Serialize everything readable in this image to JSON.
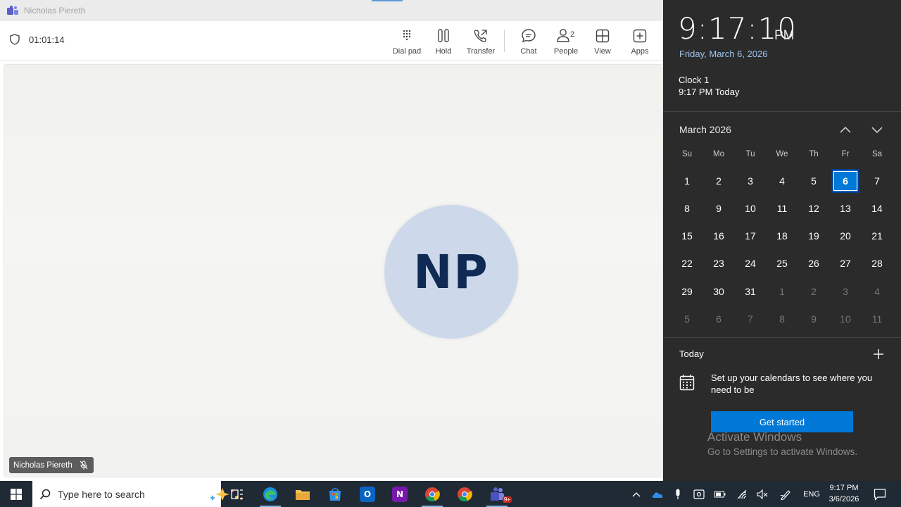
{
  "window": {
    "title": "Nicholas Piereth",
    "call_timer": "01:01:14",
    "controls": [
      {
        "label": "Dial pad",
        "icon": "dialpad-icon"
      },
      {
        "label": "Hold",
        "icon": "hold-icon"
      },
      {
        "label": "Transfer",
        "icon": "transfer-icon"
      },
      {
        "label": "Chat",
        "icon": "chat-icon"
      },
      {
        "label": "People",
        "icon": "people-icon",
        "count": "2"
      },
      {
        "label": "View",
        "icon": "view-icon"
      },
      {
        "label": "Apps",
        "icon": "apps-icon"
      }
    ],
    "avatar_initials": "NP",
    "participant_name": "Nicholas Piereth",
    "avatar_color": "#cdd9ea"
  },
  "flyout": {
    "time": "9:17:10",
    "ampm": "PM",
    "date": "Friday, March 6, 2026",
    "clock_name": "Clock 1",
    "clock_time": "9:17 PM Today",
    "month": "March 2026",
    "weekdays": [
      "Su",
      "Mo",
      "Tu",
      "We",
      "Th",
      "Fr",
      "Sa"
    ],
    "weeks": [
      [
        "1",
        "2",
        "3",
        "4",
        "5",
        "6",
        "7"
      ],
      [
        "8",
        "9",
        "10",
        "11",
        "12",
        "13",
        "14"
      ],
      [
        "15",
        "16",
        "17",
        "18",
        "19",
        "20",
        "21"
      ],
      [
        "22",
        "23",
        "24",
        "25",
        "26",
        "27",
        "28"
      ],
      [
        "29",
        "30",
        "31",
        "1",
        "2",
        "3",
        "4"
      ],
      [
        "5",
        "6",
        "7",
        "8",
        "9",
        "10",
        "11"
      ]
    ],
    "today_label": "Today",
    "setup_text": "Set up your calendars to see where you need to be",
    "get_started": "Get started",
    "watermark_title": "Activate Windows",
    "watermark_sub": "Go to Settings to activate Windows.",
    "accent": "#0078d7"
  },
  "taskbar": {
    "search_placeholder": "Type here to search",
    "language": "ENG",
    "time": "9:17 PM",
    "date": "3/6/2026",
    "teams_badge": "9+"
  }
}
